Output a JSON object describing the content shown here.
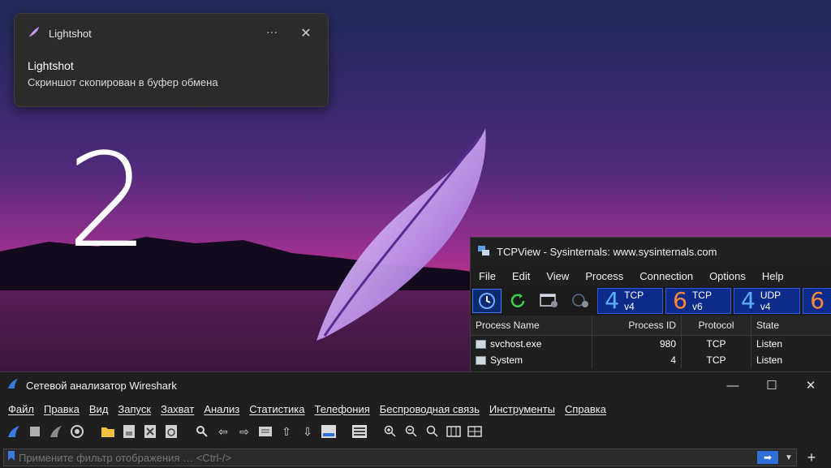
{
  "wallpaper": {
    "numeral": "2"
  },
  "notification": {
    "app_name": "Lightshot",
    "more_icon": "more-dots-icon",
    "close_icon": "close-icon",
    "title": "Lightshot",
    "message": "Скриншот скопирован в буфер обмена"
  },
  "tcpview": {
    "title": "TCPView - Sysinternals: www.sysinternals.com",
    "menu": [
      "File",
      "Edit",
      "View",
      "Process",
      "Connection",
      "Options",
      "Help"
    ],
    "toolbar": {
      "refresh_rate_icon": "clock-refresh-icon",
      "refresh_icon": "refresh-icon",
      "settings_icon": "settings-icon",
      "tcp_v4": {
        "number": "4",
        "label": "TCP v4"
      },
      "tcp_v6": {
        "number": "6",
        "label": "TCP v6"
      },
      "udp_v4": {
        "number": "4",
        "label": "UDP v4"
      },
      "udp_v6": {
        "number": "6"
      }
    },
    "columns": [
      "Process Name",
      "Process ID",
      "Protocol",
      "State"
    ],
    "rows": [
      {
        "process": "svchost.exe",
        "pid": "980",
        "protocol": "TCP",
        "state": "Listen"
      },
      {
        "process": "System",
        "pid": "4",
        "protocol": "TCP",
        "state": "Listen"
      }
    ]
  },
  "wireshark": {
    "title": "Сетевой анализатор Wireshark",
    "menu": [
      "Файл",
      "Правка",
      "Вид",
      "Запуск",
      "Захват",
      "Анализ",
      "Статистика",
      "Телефония",
      "Беспроводная связь",
      "Инструменты",
      "Справка"
    ],
    "filter": {
      "placeholder": "Примените фильтр отображения … <Ctrl-/>"
    },
    "colors": {
      "accent": "#2f6fd6",
      "toolbar_icon": "#dcdcdc"
    }
  }
}
